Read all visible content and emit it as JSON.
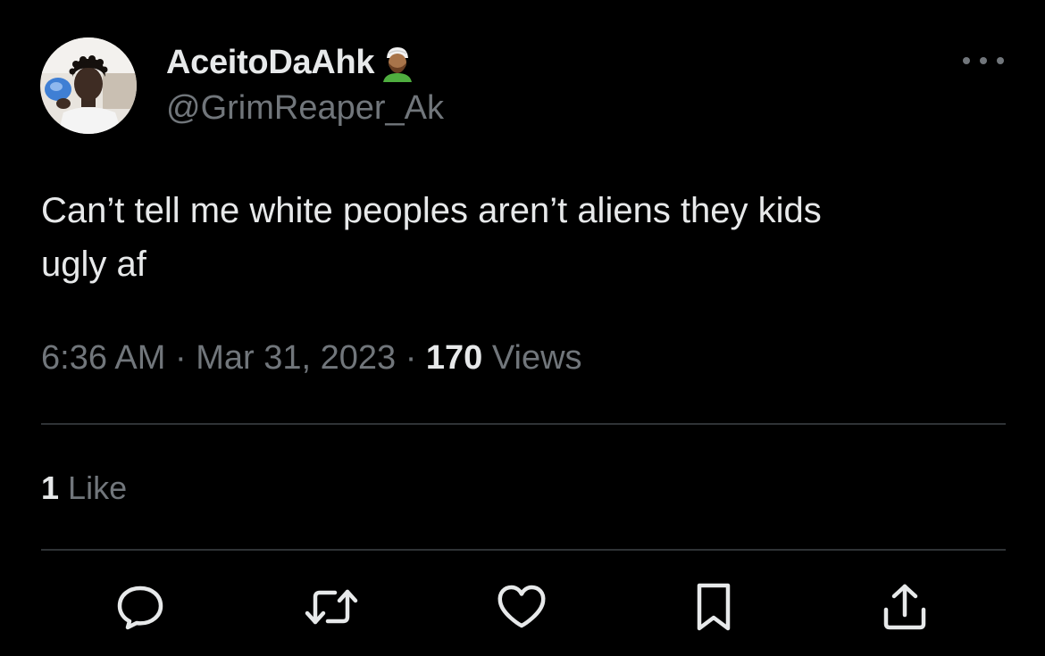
{
  "tweet": {
    "author": {
      "display_name": "AceitoDaAhk",
      "handle": "@GrimReaper_Ak",
      "name_emoji": "person-with-turban-emoji"
    },
    "text_lines": [
      "Can’t tell me white peoples aren’t aliens they kids",
      "ugly af"
    ],
    "meta": {
      "time": "6:36 AM",
      "separator": "·",
      "date": "Mar 31, 2023",
      "views_count": "170",
      "views_label": "Views"
    },
    "likes": {
      "count": "1",
      "label": "Like"
    }
  },
  "actions": [
    {
      "name": "reply",
      "icon": "speech-bubble-icon"
    },
    {
      "name": "retweet",
      "icon": "retweet-icon"
    },
    {
      "name": "like",
      "icon": "heart-icon"
    },
    {
      "name": "bookmark",
      "icon": "bookmark-icon"
    },
    {
      "name": "share",
      "icon": "share-icon"
    }
  ],
  "colors": {
    "background": "#000000",
    "primary_text": "#e7e9ea",
    "secondary_text": "#71767b",
    "divider": "#2f3336"
  }
}
